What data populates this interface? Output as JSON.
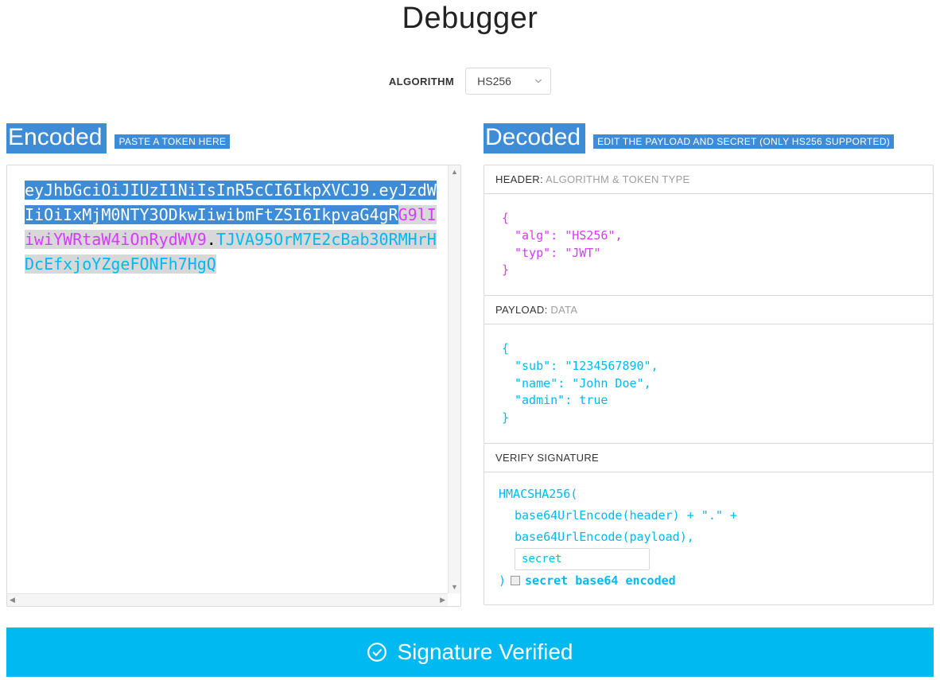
{
  "title": "Debugger",
  "algorithm": {
    "label": "ALGORITHM",
    "selected": "HS256"
  },
  "encoded": {
    "heading": "Encoded",
    "hint": "PASTE A TOKEN HERE",
    "token_header": "eyJhbGciOiJIUzI1NiIsInR5cCI6IkpXVCJ9",
    "token_payload_sel": "eyJzdWIiOiIxMjM0NTY3ODkwIiwibmFtZSI6IkpvaG4gR",
    "token_payload_rest": "G9lIiwiYWRtaW4iOnRydWV9",
    "token_signature": "TJVA95OrM7E2cBab30RMHrHDcEfxjoYZgeFONFh7HgQ"
  },
  "decoded": {
    "heading": "Decoded",
    "hint": "EDIT THE PAYLOAD AND SECRET (ONLY HS256 SUPPORTED)"
  },
  "header_panel": {
    "label": "HEADER:",
    "sub": "ALGORITHM & TOKEN TYPE",
    "alg_key": "\"alg\"",
    "alg_val": "\"HS256\"",
    "typ_key": "\"typ\"",
    "typ_val": "\"JWT\""
  },
  "payload_panel": {
    "label": "PAYLOAD:",
    "sub": "DATA",
    "sub_key": "\"sub\"",
    "sub_val": "\"1234567890\"",
    "name_key": "\"name\"",
    "name_val": "\"John Doe\"",
    "admin_key": "\"admin\"",
    "admin_val": "true"
  },
  "signature_panel": {
    "label": "VERIFY SIGNATURE",
    "line1": "HMACSHA256(",
    "line2": "base64UrlEncode(header) + \".\" +",
    "line3": "base64UrlEncode(payload),",
    "secret_value": "secret",
    "close": ")",
    "checkbox_label": "secret base64 encoded"
  },
  "verify": {
    "text": "Signature Verified"
  }
}
